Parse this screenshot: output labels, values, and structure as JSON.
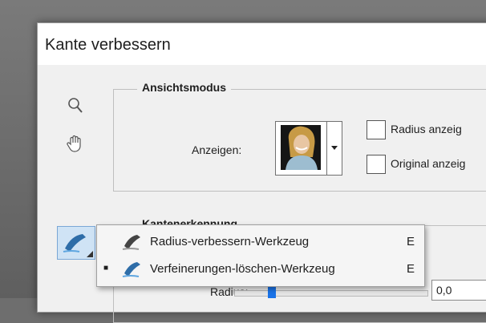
{
  "dialog": {
    "title": "Kante verbessern"
  },
  "view_mode": {
    "legend": "Ansichtsmodus",
    "show_label": "Anzeigen:",
    "checkboxes": [
      {
        "label": "Radius anzeig",
        "checked": false
      },
      {
        "label": "Original anzeig",
        "checked": false
      }
    ]
  },
  "edge_detection": {
    "legend": "Kantenerkennung",
    "radius_label": "Radius:",
    "radius_value": "0,0"
  },
  "tool_menu": {
    "items": [
      {
        "label": "Radius-verbessern-Werkzeug",
        "shortcut": "E",
        "selected": false
      },
      {
        "label": "Verfeinerungen-löschen-Werkzeug",
        "shortcut": "E",
        "selected": true
      }
    ],
    "bullet": "■"
  },
  "icons": [
    "zoom-icon",
    "hand-icon",
    "refine-radius-icon",
    "erase-refinements-icon"
  ],
  "colors": {
    "accent": "#1a73e8",
    "tool_highlight": "#cfe3f5"
  }
}
